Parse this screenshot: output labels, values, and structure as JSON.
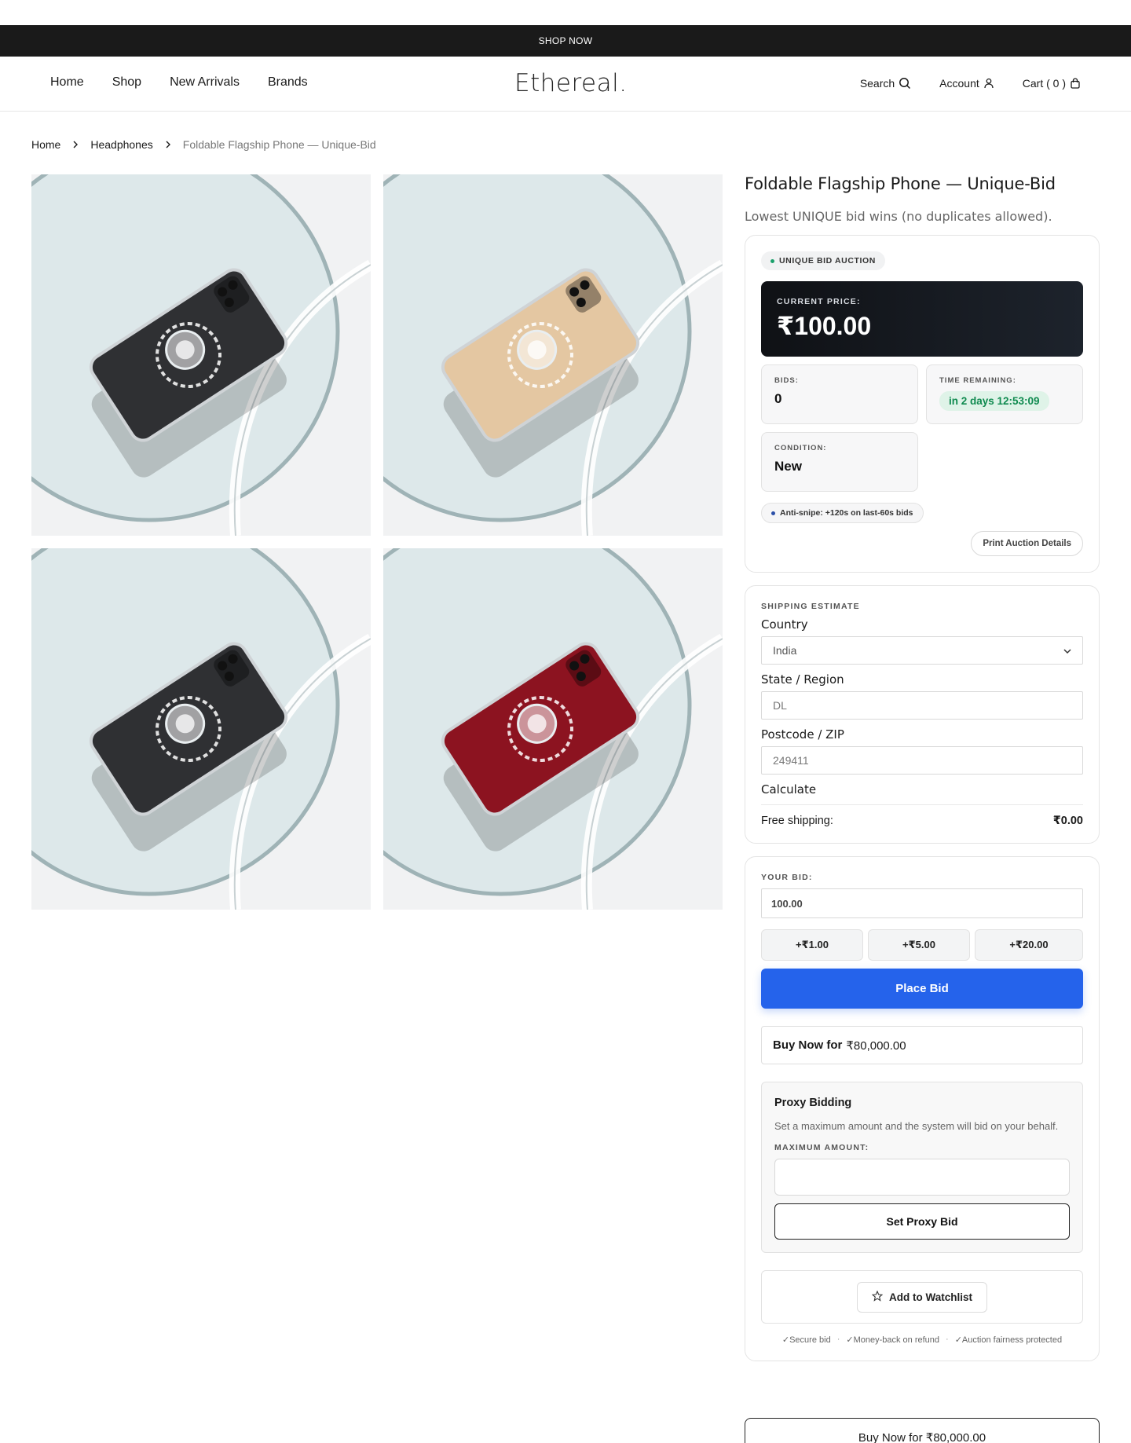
{
  "announcement": "SHOP NOW",
  "nav": {
    "left": [
      "Home",
      "Shop",
      "New Arrivals",
      "Brands"
    ],
    "logo": "Ethereal.",
    "search": "Search",
    "account": "Account",
    "cart": "Cart ( 0 )"
  },
  "breadcrumb": [
    "Home",
    "Headphones",
    "Foldable Flagship Phone — Unique-Bid"
  ],
  "gallery": [
    {
      "variant": "Black",
      "case_color": "#2f3033"
    },
    {
      "variant": "Gold",
      "case_color": "#e4c7a2"
    },
    {
      "variant": "Black",
      "case_color": "#2f3033"
    },
    {
      "variant": "Red",
      "case_color": "#8c1320"
    }
  ],
  "product": {
    "title": "Foldable Flagship Phone — Unique-Bid",
    "subtitle": "Lowest UNIQUE bid wins (no duplicates allowed)."
  },
  "auction": {
    "badge": "UNIQUE BID AUCTION",
    "current_price_label": "CURRENT PRICE:",
    "current_price": "₹100.00",
    "bids_label": "BIDS:",
    "bids": "0",
    "time_label": "TIME REMAINING:",
    "time_remaining": "in 2 days 12:53:09",
    "condition_label": "CONDITION:",
    "condition": "New",
    "anti_snipe": "Anti-snipe: +120s on last-60s bids",
    "print_button": "Print Auction Details"
  },
  "shipping": {
    "heading": "SHIPPING ESTIMATE",
    "country_label": "Country",
    "country_value": "India",
    "state_label": "State / Region",
    "state_placeholder": "DL",
    "postcode_label": "Postcode / ZIP",
    "postcode_placeholder": "249411",
    "calculate": "Calculate",
    "result_label": "Free shipping:",
    "result_value": "₹0.00"
  },
  "bid": {
    "label": "YOUR BID:",
    "value": "100.00",
    "increments": [
      "+₹1.00",
      "+₹5.00",
      "+₹20.00"
    ],
    "place_button": "Place Bid",
    "buy_now_label": "Buy Now for",
    "buy_now_price": "₹80,000.00"
  },
  "proxy": {
    "title": "Proxy Bidding",
    "description": "Set a maximum amount and the system will bid on your behalf.",
    "max_label": "MAXIMUM AMOUNT:",
    "button": "Set Proxy Bid"
  },
  "watchlist": {
    "button": "Add to Watchlist"
  },
  "trust": [
    "✓Secure bid",
    "✓Money-back on refund",
    "✓Auction fairness protected"
  ],
  "buy_now_bottom": "Buy Now for ₹80,000.00",
  "colors": {
    "accent": "#2563eb",
    "timer_green": "#0f8a4f",
    "dark": "#1a1a1a"
  }
}
